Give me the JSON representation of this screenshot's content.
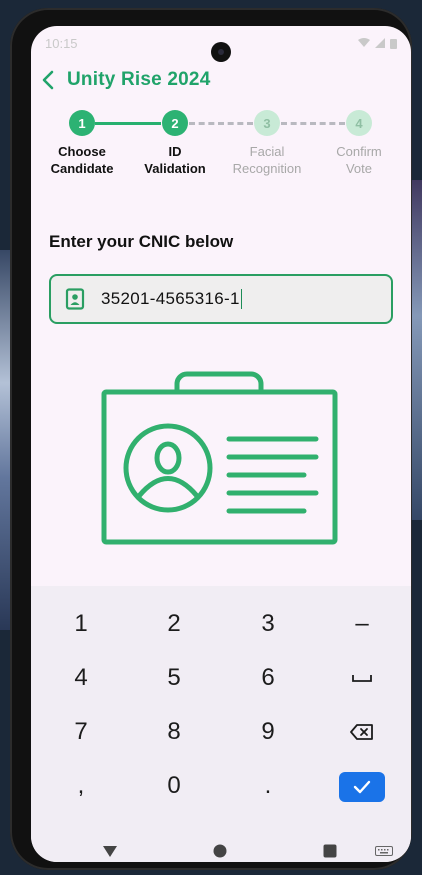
{
  "status_bar": {
    "time": "10:15",
    "icons": [
      "wifi-icon",
      "signal-icon",
      "battery-icon"
    ]
  },
  "app_bar": {
    "title": "Unity Rise 2024",
    "back_icon": "chevron-left-icon"
  },
  "stepper": {
    "steps": [
      {
        "number": "1",
        "label": "Choose\nCandidate",
        "state": "active"
      },
      {
        "number": "2",
        "label": "ID\nValidation",
        "state": "active"
      },
      {
        "number": "3",
        "label": "Facial\nRecognition",
        "state": "inactive"
      },
      {
        "number": "4",
        "label": "Confirm\nVote",
        "state": "inactive"
      }
    ]
  },
  "form": {
    "prompt": "Enter your CNIC below",
    "cnic_value": "35201-4565316-1",
    "input_icon": "id-badge-icon"
  },
  "illustration": {
    "icon": "id-card-icon"
  },
  "keyboard": {
    "rows": [
      [
        "1",
        "2",
        "3",
        "–"
      ],
      [
        "4",
        "5",
        "6",
        "space"
      ],
      [
        "7",
        "8",
        "9",
        "backspace"
      ],
      [
        ",",
        "0",
        ".",
        "done"
      ]
    ]
  },
  "colors": {
    "accent": "#2cb273",
    "title": "#20a36a",
    "border": "#2a9e62",
    "done_key": "#1a73e8"
  }
}
